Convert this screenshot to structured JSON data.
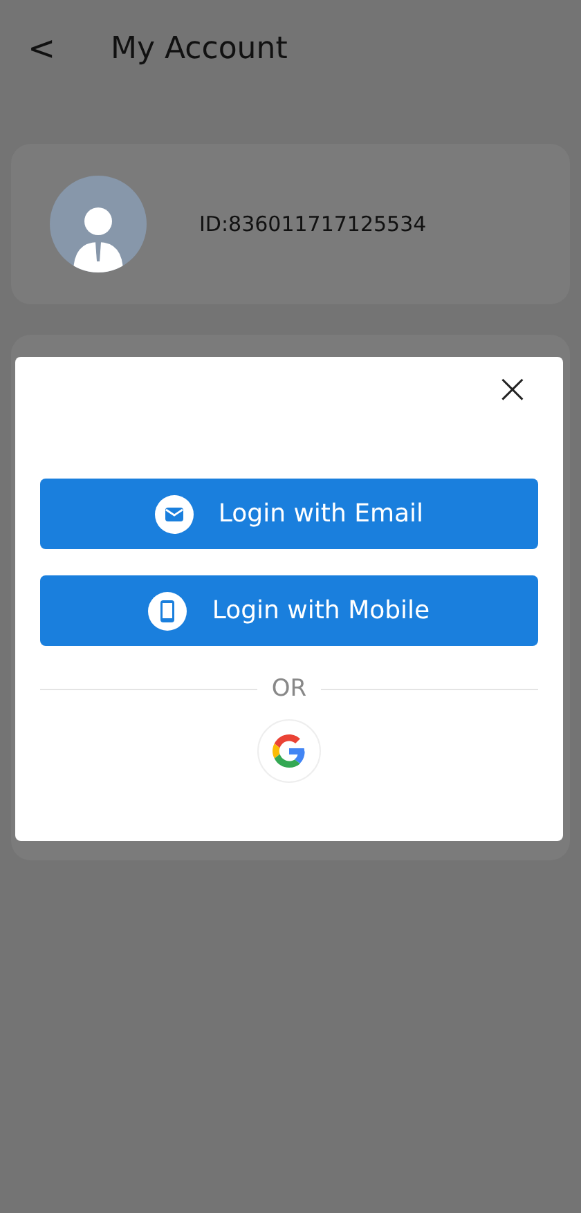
{
  "header": {
    "back": "<",
    "title": "My Account"
  },
  "profile": {
    "id_text": "ID:836011717125534"
  },
  "login_dialog": {
    "close": "×",
    "buttons": [
      {
        "kind": "email",
        "label": "Login with Email"
      },
      {
        "kind": "mobile",
        "label": "Login with Mobile"
      }
    ],
    "divider": "OR",
    "social": [
      {
        "kind": "google"
      }
    ]
  }
}
